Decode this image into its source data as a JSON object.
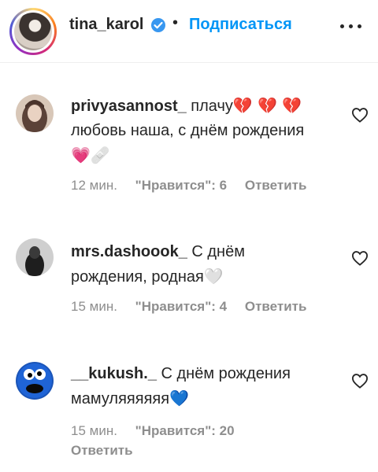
{
  "header": {
    "username": "tina_karol",
    "separator": "•",
    "follow_label": "Подписаться"
  },
  "comments": [
    {
      "username": "privyasannost_",
      "text_1": "плачу",
      "emoji_1": "💔 💔 💔",
      "text_2": "любовь наша, с днём рождения",
      "emoji_2a": "💗",
      "emoji_2b": "🩹",
      "time": "12 мин.",
      "likes": "\"Нравится\": 6",
      "reply": "Ответить"
    },
    {
      "username": "mrs.dashoook_",
      "text_1": "С днём",
      "text_2": "рождения, родная",
      "emoji_1": "🤍",
      "time": "15 мин.",
      "likes": "\"Нравится\": 4",
      "reply": "Ответить"
    },
    {
      "username": "__kukush._",
      "text_1": "С днём рождения",
      "text_2": "мамуляяяяяя",
      "emoji_1": "💙",
      "time": "15 мин.",
      "likes": "\"Нравится\": 20",
      "reply": "Ответить"
    }
  ],
  "colors": {
    "link": "#0095f6",
    "meta": "#8e8e8e",
    "text": "#262626",
    "verified": "#3897f0"
  },
  "icons": [
    "verified-badge-icon",
    "more-options-icon",
    "heart-icon"
  ]
}
